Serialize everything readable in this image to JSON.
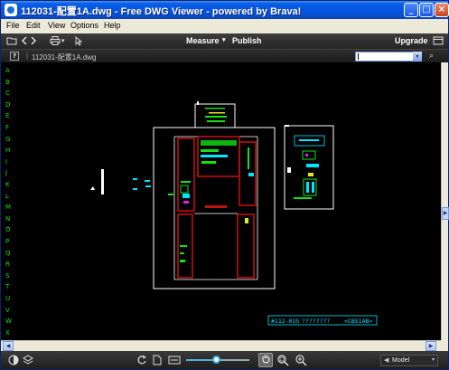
{
  "window": {
    "title": "112031-配置1A.dwg - Free DWG Viewer - powered by Brava!",
    "min_glyph": "_",
    "max_glyph": "□",
    "close_glyph": "×"
  },
  "menu": [
    "File",
    "Edit",
    "View",
    "Options",
    "Help"
  ],
  "toolbar": {
    "measure_label": "Measure",
    "dropdown_glyph": "▾",
    "publish_label": "Publish",
    "upgrade_label": "Upgrade"
  },
  "filebar": {
    "help_glyph": "?",
    "separator": "|",
    "file_name": "112031-配置1A.dwg",
    "search_value": "",
    "find_glyph": "⌕"
  },
  "ruler_letters": [
    "A",
    "B",
    "C",
    "D",
    "E",
    "F",
    "G",
    "H",
    "I",
    "J",
    "K",
    "L",
    "M",
    "N",
    "O",
    "P",
    "Q",
    "R",
    "S",
    "T",
    "U",
    "V",
    "W",
    "X"
  ],
  "drawing": {
    "label_code": "#112-035",
    "label_placeholder": "????????",
    "label_tag": "<CBS1AB>",
    "colors": {
      "outline": "#ffffff",
      "green": "#14e014",
      "cyan": "#00e5ff",
      "red": "#c01010",
      "magenta": "#e020e0",
      "yellow": "#e8e820"
    }
  },
  "statusbar": {
    "model_label": "Model"
  },
  "icons": {
    "toolbar": [
      "folder-icon",
      "back-arrow-icon",
      "forward-arrow-icon",
      "print-icon",
      "select-cursor-icon"
    ],
    "bottom": [
      "contrast-icon",
      "layers-icon",
      "rotate-icon",
      "page-icon",
      "fit-window-icon",
      "pan-hand-icon",
      "zoom-window-icon",
      "zoom-in-icon"
    ]
  }
}
